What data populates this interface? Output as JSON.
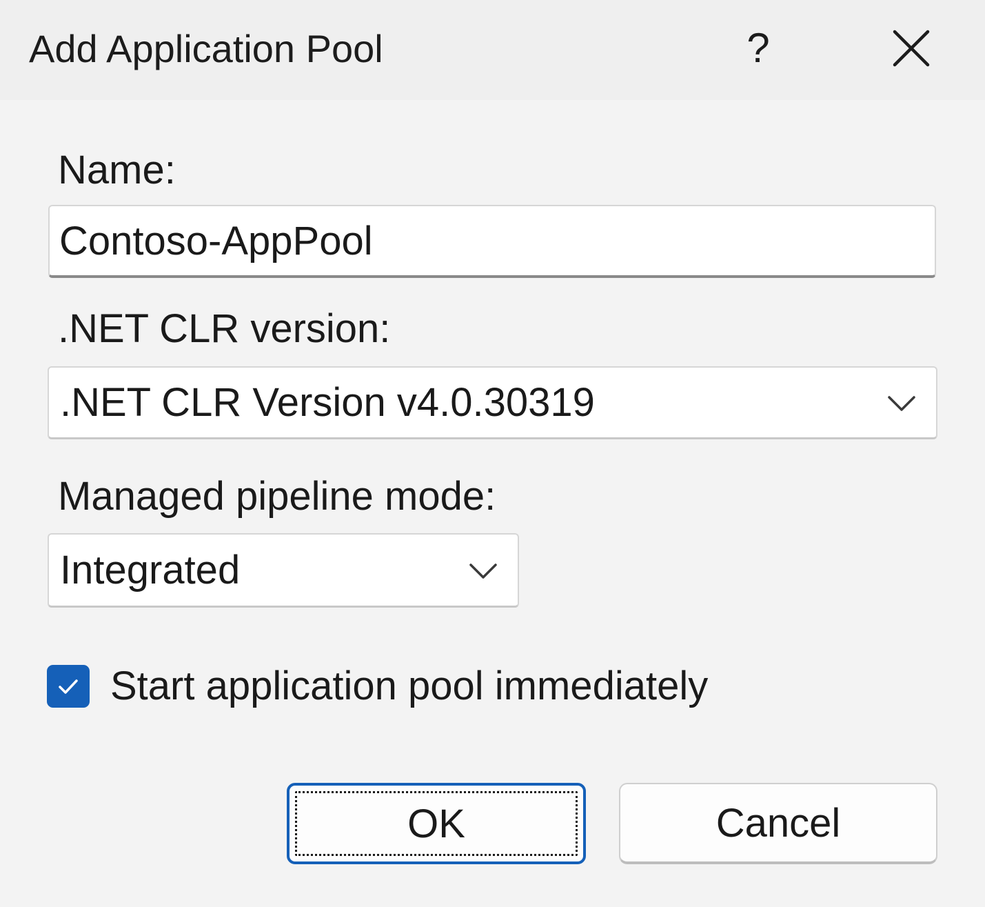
{
  "dialog": {
    "title": "Add Application Pool",
    "help_label": "?",
    "close_icon": "close-icon"
  },
  "form": {
    "name_label": "Name:",
    "name_value": "Contoso-AppPool",
    "clr_label": ".NET CLR version:",
    "clr_value": ".NET CLR Version v4.0.30319",
    "pipeline_label": "Managed pipeline mode:",
    "pipeline_value": "Integrated",
    "start_label": "Start application pool immediately",
    "start_checked": true
  },
  "buttons": {
    "ok_label": "OK",
    "cancel_label": "Cancel"
  },
  "colors": {
    "accent": "#1560b8",
    "background": "#f2f2f2"
  }
}
